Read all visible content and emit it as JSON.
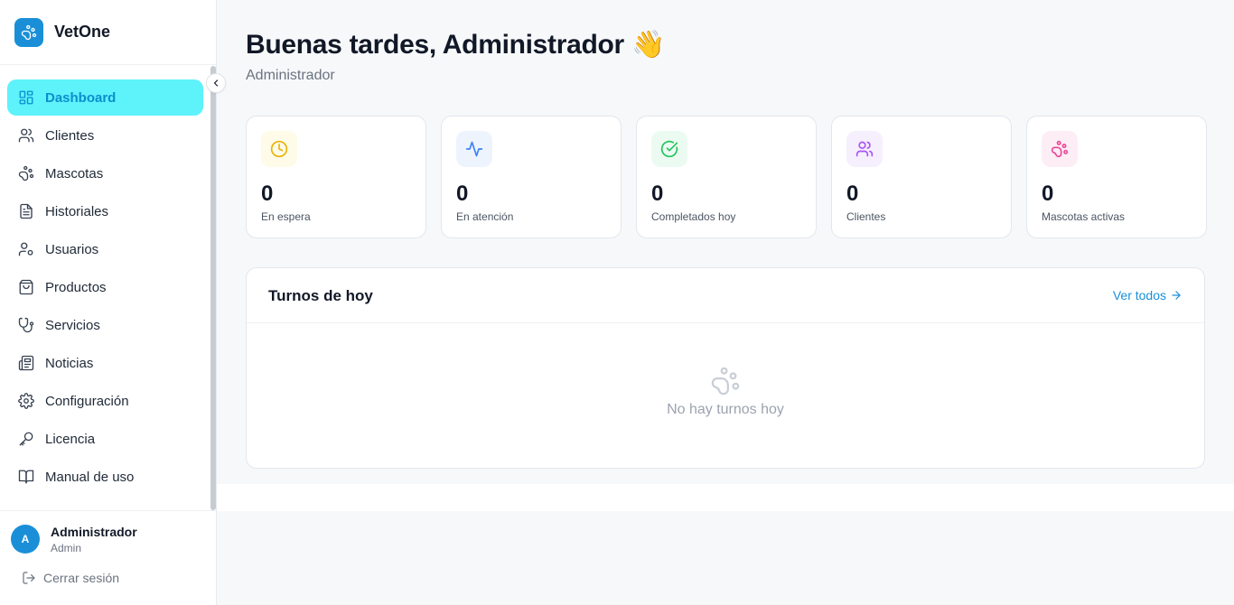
{
  "brand": {
    "name": "VetOne",
    "logo_icon": "paw-icon",
    "accent": "#1a8fd8"
  },
  "sidebar": {
    "collapse_icon": "chevron-left-icon",
    "items": [
      {
        "label": "Dashboard",
        "icon": "dashboard-icon",
        "active": true
      },
      {
        "label": "Clientes",
        "icon": "users-icon"
      },
      {
        "label": "Mascotas",
        "icon": "paw-icon"
      },
      {
        "label": "Historiales",
        "icon": "file-text-icon"
      },
      {
        "label": "Usuarios",
        "icon": "user-cog-icon"
      },
      {
        "label": "Productos",
        "icon": "shopping-bag-icon"
      },
      {
        "label": "Servicios",
        "icon": "stethoscope-icon"
      },
      {
        "label": "Noticias",
        "icon": "newspaper-icon"
      },
      {
        "label": "Configuración",
        "icon": "gear-icon"
      },
      {
        "label": "Licencia",
        "icon": "key-icon"
      },
      {
        "label": "Manual de uso",
        "icon": "book-icon"
      }
    ],
    "active_bg": "#5ef2fb",
    "active_color": "#0a8fcc"
  },
  "user": {
    "initial": "A",
    "name": "Administrador",
    "role": "Admin",
    "logout_label": "Cerrar sesión"
  },
  "header": {
    "greeting": "Buenas tardes, Administrador 👋",
    "subtitle": "Administrador"
  },
  "stats": [
    {
      "value": "0",
      "label": "En espera",
      "icon": "clock-icon",
      "color": "#eab308",
      "bg": "#fefbe8"
    },
    {
      "value": "0",
      "label": "En atención",
      "icon": "activity-icon",
      "color": "#3b82f6",
      "bg": "#eef4fe"
    },
    {
      "value": "0",
      "label": "Completados hoy",
      "icon": "check-circle-icon",
      "color": "#22c55e",
      "bg": "#ecfbf2"
    },
    {
      "value": "0",
      "label": "Clientes",
      "icon": "users-icon",
      "color": "#a855f7",
      "bg": "#f6effe"
    },
    {
      "value": "0",
      "label": "Mascotas activas",
      "icon": "paw-icon",
      "color": "#ec4899",
      "bg": "#fdeef5"
    }
  ],
  "today": {
    "title": "Turnos de hoy",
    "link": "Ver todos",
    "empty_text": "No hay turnos hoy",
    "empty_icon": "paw-icon"
  }
}
